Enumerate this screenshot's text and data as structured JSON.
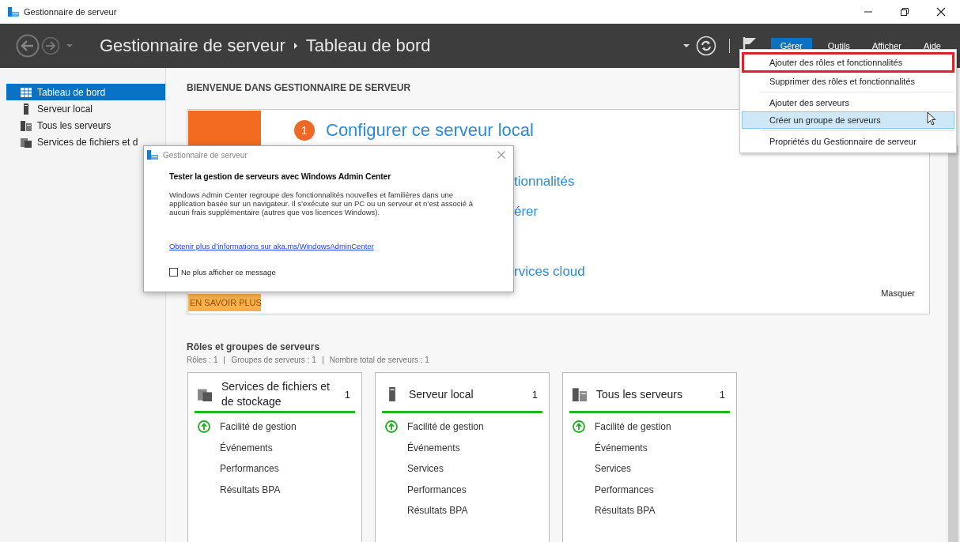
{
  "window": {
    "title": "Gestionnaire de serveur"
  },
  "header": {
    "breadcrumb": [
      "Gestionnaire de serveur",
      "Tableau de bord"
    ],
    "menus": [
      {
        "label": "Gérer",
        "selected": true
      },
      {
        "label": "Outils",
        "selected": false
      },
      {
        "label": "Afficher",
        "selected": false
      },
      {
        "label": "Aide",
        "selected": false
      }
    ]
  },
  "dropdown": {
    "groups": [
      [
        {
          "label": "Ajouter des rôles et fonctionnalités",
          "selected": false,
          "outlined": true
        },
        {
          "label": "Supprimer des rôles et fonctionnalités",
          "selected": false,
          "outlined": false
        }
      ],
      [
        {
          "label": "Ajouter des serveurs",
          "selected": false,
          "outlined": false
        },
        {
          "label": "Créer un groupe de serveurs",
          "selected": true,
          "outlined": false
        }
      ],
      [
        {
          "label": "Propriétés du Gestionnaire de serveur",
          "selected": false,
          "outlined": false
        }
      ]
    ]
  },
  "sidebar": {
    "items": [
      {
        "label": "Tableau de bord",
        "kind": "dashboard",
        "selected": true
      },
      {
        "label": "Serveur local",
        "kind": "server",
        "selected": false
      },
      {
        "label": "Tous les serveurs",
        "kind": "servers",
        "selected": false
      },
      {
        "label": "Services de fichiers et d",
        "kind": "files",
        "selected": false
      }
    ]
  },
  "welcome": {
    "heading": "BIENVENUE DANS GESTIONNAIRE DE SERVEUR",
    "step_number": "1",
    "step_title": "Configurer ce serveur local",
    "items": [
      "tionnalités",
      "érer",
      "rvices cloud"
    ],
    "learn_more": "EN SAVOIR PLUS",
    "hide": "Masquer"
  },
  "dialog": {
    "title": "Gestionnaire de serveur",
    "heading": "Tester la gestion de serveurs avec Windows Admin Center",
    "body": "Windows Admin Center regroupe des fonctionnalités nouvelles et familières dans une application basée sur un navigateur. Il s’exécute sur un PC ou un serveur et n’est associé à aucun frais supplémentaire (autres que vos licences Windows).",
    "link": "Obtenir plus d’informations sur aka.ms/WindowsAdminCenter",
    "checkbox": {
      "label": "Ne plus afficher ce message",
      "checked": false
    }
  },
  "roles": {
    "title": "Rôles et groupes de serveurs",
    "summary": [
      "Rôles : 1",
      "Groupes de serveurs : 1",
      "Nombre total de serveurs : 1"
    ],
    "tiles": [
      {
        "kind": "files",
        "title": "Services de fichiers et de stockage",
        "count": "1",
        "rows": [
          {
            "label": "Facilité de gestion",
            "ok": true
          },
          {
            "label": "Événements",
            "ok": false
          },
          {
            "label": "Performances",
            "ok": false
          },
          {
            "label": "Résultats BPA",
            "ok": false
          }
        ]
      },
      {
        "kind": "server",
        "title": "Serveur local",
        "count": "1",
        "rows": [
          {
            "label": "Facilité de gestion",
            "ok": true
          },
          {
            "label": "Événements",
            "ok": false
          },
          {
            "label": "Services",
            "ok": false
          },
          {
            "label": "Performances",
            "ok": false
          },
          {
            "label": "Résultats BPA",
            "ok": false
          }
        ]
      },
      {
        "kind": "servers",
        "title": "Tous les serveurs",
        "count": "1",
        "rows": [
          {
            "label": "Facilité de gestion",
            "ok": true
          },
          {
            "label": "Événements",
            "ok": false
          },
          {
            "label": "Services",
            "ok": false
          },
          {
            "label": "Performances",
            "ok": false
          },
          {
            "label": "Résultats BPA",
            "ok": false
          }
        ]
      }
    ]
  }
}
